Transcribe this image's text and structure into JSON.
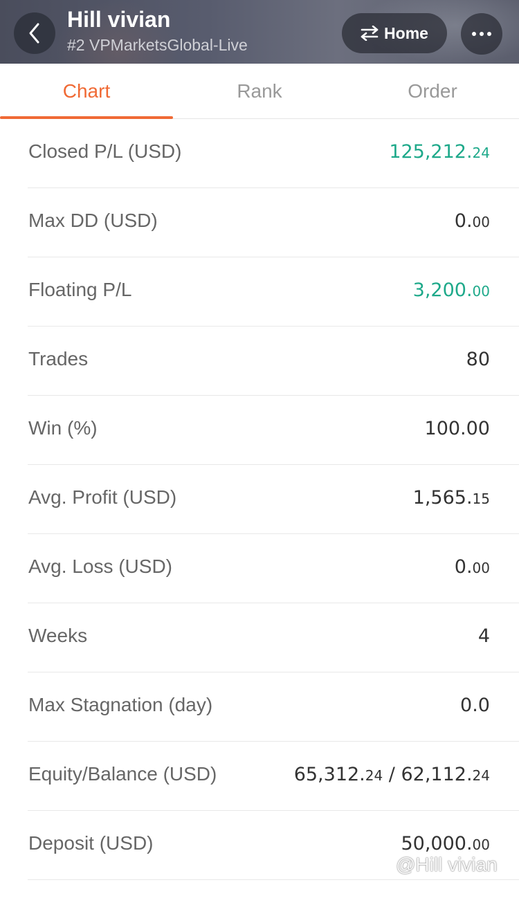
{
  "header": {
    "title": "Hill vivian",
    "subtitle": "#2 VPMarketsGlobal-Live",
    "home_label": "Home",
    "back_icon": "chevron-left-icon",
    "swap_icon": "swap-arrows-icon",
    "more_icon": "more-dots-icon"
  },
  "tabs": [
    {
      "label": "Chart",
      "active": true
    },
    {
      "label": "Rank",
      "active": false
    },
    {
      "label": "Order",
      "active": false
    }
  ],
  "colors": {
    "accent": "#f06a35",
    "positive": "#1ea98a"
  },
  "stats": [
    {
      "label": "Closed P/L (USD)",
      "int": "125,212.",
      "dec": "24",
      "color": "green"
    },
    {
      "label": "Max DD (USD)",
      "int": "0.",
      "dec": "00",
      "color": "default"
    },
    {
      "label": "Floating P/L",
      "int": "3,200.",
      "dec": "00",
      "color": "green"
    },
    {
      "label": "Trades",
      "int": "80",
      "dec": "",
      "color": "default"
    },
    {
      "label": "Win (%)",
      "int": "100.00",
      "dec": "",
      "color": "default"
    },
    {
      "label": "Avg. Profit (USD)",
      "int": "1,565.",
      "dec": "15",
      "color": "default"
    },
    {
      "label": "Avg. Loss (USD)",
      "int": "0.",
      "dec": "00",
      "color": "default"
    },
    {
      "label": "Weeks",
      "int": "4",
      "dec": "",
      "color": "default"
    },
    {
      "label": "Max Stagnation (day)",
      "int": "0.0",
      "dec": "",
      "color": "default"
    },
    {
      "label": "Equity/Balance (USD)",
      "int": "65,312.",
      "dec": "24",
      "sep": " / ",
      "int2": "62,112.",
      "dec2": "24",
      "color": "default"
    },
    {
      "label": "Deposit (USD)",
      "int": "50,000.",
      "dec": "00",
      "color": "default"
    }
  ],
  "watermark": "@Hill vivian"
}
